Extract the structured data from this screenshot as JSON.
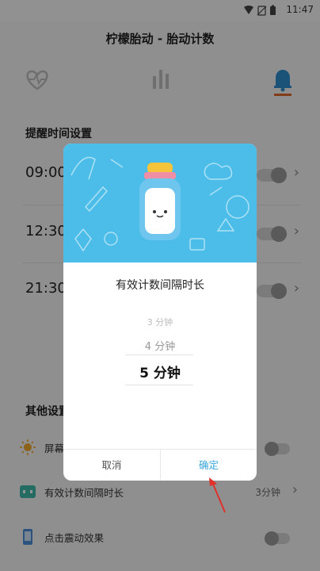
{
  "status_bar": {
    "time": "11:47"
  },
  "header": {
    "title": "柠檬胎动 - 胎动计数"
  },
  "tabs": [
    {
      "icon": "heart-pulse-icon",
      "active": false
    },
    {
      "icon": "bar-chart-icon",
      "active": false
    },
    {
      "icon": "bell-icon",
      "active": true
    }
  ],
  "reminder_section": {
    "title": "提醒时间设置",
    "rows": [
      {
        "time": "09:00"
      },
      {
        "time": "12:30"
      },
      {
        "time": "21:30"
      }
    ]
  },
  "other_section": {
    "title": "其他设置",
    "items": [
      {
        "label": "屏幕",
        "icon": "sun-icon",
        "control": "toggle"
      },
      {
        "label": "有效计数间隔时长",
        "icon": "interval-icon",
        "value": "3分钟",
        "control": "chevron"
      },
      {
        "label": "点击震动效果",
        "icon": "phone-vibrate-icon",
        "control": "toggle"
      }
    ]
  },
  "dialog": {
    "title": "有效计数间隔时长",
    "options": [
      "3 分钟",
      "4 分钟",
      "5 分钟"
    ],
    "selected": "5 分钟",
    "cancel_label": "取消",
    "confirm_label": "确定"
  },
  "colors": {
    "accent": "#3aa7dc",
    "banner": "#4bbde8",
    "tab_underline": "#e06a2a",
    "pointer": "#e0302a"
  }
}
